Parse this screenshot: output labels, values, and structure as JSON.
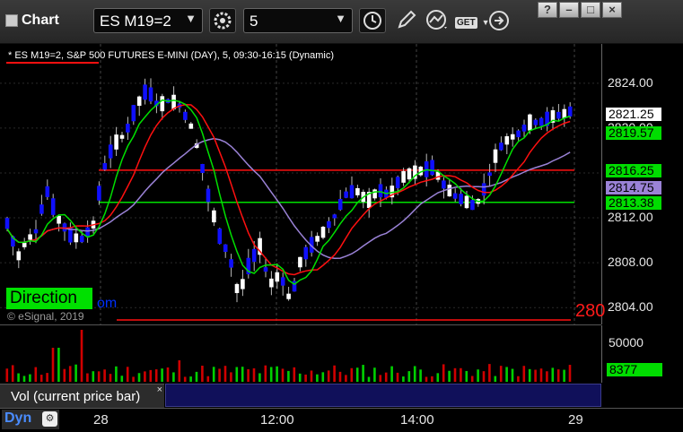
{
  "toolbar": {
    "app_title": "Chart",
    "symbol": "ES M19=2",
    "interval": "5",
    "get_label": "GET"
  },
  "window_buttons": {
    "help": "?",
    "minimize": "–",
    "restore": "□",
    "close": "×"
  },
  "chart_header": {
    "title": "* ES M19=2, S&P 500 FUTURES E-MINI (DAY), 5, 09:30-16:15 (Dynamic)"
  },
  "price_axis": {
    "ticks": [
      "2824.00",
      "2820.00",
      "2816.00",
      "2812.00",
      "2808.00",
      "2804.00"
    ]
  },
  "price_tags": [
    {
      "value": "2821.25",
      "bg": "#ffffff",
      "fg": "#000000"
    },
    {
      "value": "2819.57",
      "bg": "#00dd00",
      "fg": "#000000"
    },
    {
      "value": "2816.25",
      "bg": "#00dd00",
      "fg": "#000000"
    },
    {
      "value": "2814.75",
      "bg": "#9a82d6",
      "fg": "#000000"
    },
    {
      "value": "2813.38",
      "bg": "#00dd00",
      "fg": "#000000"
    }
  ],
  "overlay": {
    "direction": "Direction",
    "direction_suffix": "om",
    "copyright": "© eSignal, 2019",
    "bottom_red": "280"
  },
  "volume_axis": {
    "ticks": [
      "50000"
    ],
    "last": "8377"
  },
  "volume_legend": {
    "label": "Vol (current price bar)",
    "close": "×"
  },
  "time_axis": {
    "labels": [
      "28",
      "12:00",
      "14:00",
      "29"
    ]
  },
  "status": {
    "dyn": "Dyn"
  },
  "colors": {
    "up_candle": "#ffffff",
    "down_candle": "#1010ff",
    "ma_green": "#00e000",
    "ma_red": "#ff1010",
    "ma_purple": "#9a82d6",
    "level_red": "#ff1010",
    "level_green": "#00e000"
  },
  "chart_data": {
    "type": "candlestick",
    "title": "* ES M19=2, S&P 500 FUTURES E-MINI (DAY), 5, 09:30-16:15 (Dynamic)",
    "ylim": [
      2802.5,
      2827.5
    ],
    "y_ticks": [
      2824,
      2820,
      2816,
      2812,
      2808,
      2804
    ],
    "x_labels": [
      "28",
      "12:00",
      "14:00",
      "29"
    ],
    "horizontal_levels": [
      {
        "price": 2816.25,
        "color": "red"
      },
      {
        "price": 2813.38,
        "color": "green"
      },
      {
        "price": 2802.9,
        "color": "red"
      }
    ],
    "moving_average_series": [
      {
        "color": "red",
        "last": 2814.7
      },
      {
        "color": "purple",
        "last": 2814.75
      },
      {
        "color": "green",
        "last": 2819.57
      }
    ],
    "last_price": 2821.25,
    "volume_last": 8377
  }
}
